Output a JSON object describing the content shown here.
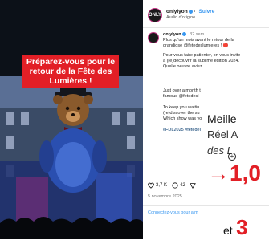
{
  "reel": {
    "banner_text": "Préparez-vous pour le retour de la Fête des Lumières !"
  },
  "post": {
    "username": "onlylyon",
    "follow_label": "Suivre",
    "audio": "Audio d'origine",
    "caption_time": "32 sem",
    "caption_lines": [
      "Plus qu'un mois avant le retour de la",
      "grandiose @fetedeslumieres ! 🔴",
      "",
      "Pour vous faire patienter, on vous invite",
      "à (re)découvrir la sublime édition 2024.",
      "Quelle oeuvre aviez",
      "",
      "—",
      "",
      "Just over a month t",
      "famous @fetedesl",
      "",
      "To keep you waitin",
      "(re)discover the su",
      "Which show was yo",
      "",
      "#FDL2025 #fetedel"
    ],
    "likes": "3,7 K",
    "comments": "42",
    "date": "5 novembre 2025",
    "login_text": "Connectez-vous pour aim"
  },
  "article": {
    "heading": "Meille",
    "line1": "Réel A",
    "line2": "des L",
    "stat_big": "→1,0",
    "stat_et": "et",
    "stat_big2": "3"
  },
  "colors": {
    "accent_red": "#e21f26",
    "link_blue": "#3897f0"
  }
}
